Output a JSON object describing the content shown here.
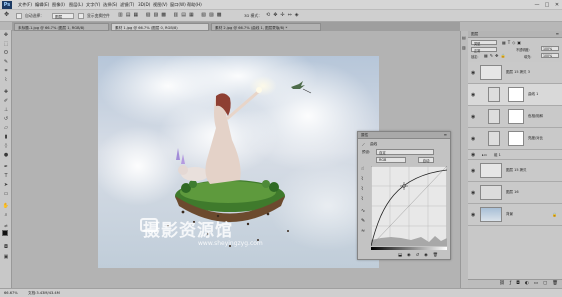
{
  "app": {
    "logo": "Ps"
  },
  "menu": [
    "文件(F)",
    "编辑(E)",
    "图像(I)",
    "图层(L)",
    "文字(Y)",
    "选择(S)",
    "滤镜(T)",
    "3D(D)",
    "视图(V)",
    "窗口(W)",
    "帮助(H)"
  ],
  "window_controls": [
    "—",
    "□",
    "✕"
  ],
  "options_bar": {
    "auto_select_label": "自动选择：",
    "auto_select_value": "图层",
    "show_transform_label": "显示变换控件",
    "mode_3d_label": "3D 模式："
  },
  "tabs": [
    {
      "label": "未标题-1.jpg @ 66.7% (图层 1, RGB/8)"
    },
    {
      "label": "素材 1.jpg @ 66.7% (图层 0, RGB/8)"
    },
    {
      "label": "素材 2.jpg @ 66.7% (曲线 1, 图层蒙版/8) *"
    }
  ],
  "tools": [
    "move",
    "marquee",
    "lasso",
    "quick-select",
    "crop",
    "eyedropper",
    "heal",
    "brush",
    "stamp",
    "history",
    "eraser",
    "gradient",
    "blur",
    "dodge",
    "pen",
    "type",
    "path-select",
    "shape",
    "hand",
    "zoom"
  ],
  "status": {
    "zoom": "66.67%",
    "doc": "文档:3.43M/43.4M"
  },
  "watermark": {
    "text": "摄影资源馆",
    "url": "www.sheyingzyg.com"
  },
  "layers_panel": {
    "title": "图层",
    "search_placeholder": "类型",
    "blend_mode": "正常",
    "opacity_label": "不透明度:",
    "opacity_value": "100%",
    "lock_label": "锁定:",
    "fill_label": "填充:",
    "fill_value": "100%",
    "layers": [
      {
        "name": "图层 15 拷贝 3",
        "selected": false
      },
      {
        "name": "曲线 1",
        "selected": true
      },
      {
        "name": "色相/饱和",
        "selected": false
      },
      {
        "name": "亮度/对比",
        "selected": false
      },
      {
        "name": "组 1",
        "selected": false
      },
      {
        "name": "图层 15 拷贝",
        "selected": false
      },
      {
        "name": "图层 16",
        "selected": false
      },
      {
        "name": "背景",
        "selected": false
      }
    ]
  },
  "properties_panel": {
    "title": "属性",
    "adjustment_title": "曲线",
    "preset_label": "预设:",
    "preset_value": "自定",
    "channel_value": "RGB",
    "auto_label": "自动"
  },
  "colors": {
    "accent": "#1c3a63",
    "canvas_bg": "#b3b3b3",
    "panel_bg": "#c8c8c8"
  }
}
